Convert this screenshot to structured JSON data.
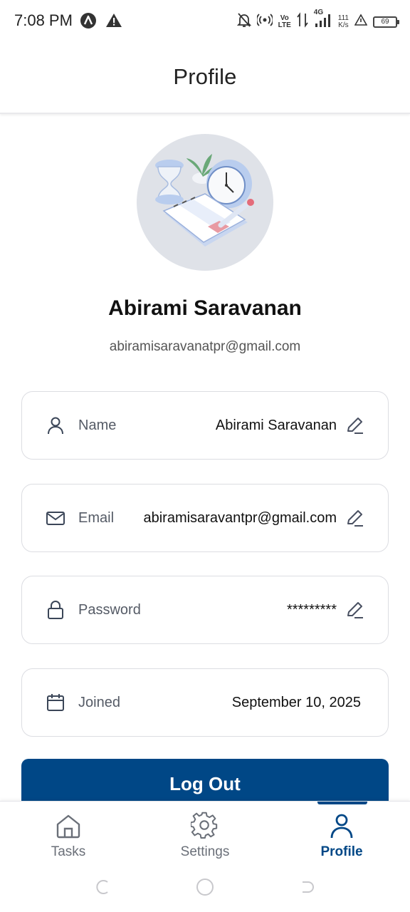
{
  "status_bar": {
    "time": "7:08 PM",
    "network_type": "4G",
    "speed_value": "111",
    "speed_unit": "K/s",
    "battery": "69",
    "volte_top": "Vo",
    "volte_bottom": "LTE",
    "icons": [
      "app-a-icon",
      "warning-icon",
      "bell-off-icon",
      "hotspot-icon",
      "data-arrows-icon",
      "signal-icon",
      "alert-triangle-icon",
      "battery-icon"
    ]
  },
  "header": {
    "title": "Profile"
  },
  "profile": {
    "name": "Abirami Saravanan",
    "email": "abiramisaravanatpr@gmail.com"
  },
  "fields": [
    {
      "label": "Name",
      "value": "Abirami Saravanan",
      "icon": "user-icon",
      "editable": true
    },
    {
      "label": "Email",
      "value": "abiramisaravantpr@gmail.com",
      "icon": "mail-icon",
      "editable": true
    },
    {
      "label": "Password",
      "value": "*********",
      "icon": "lock-icon",
      "editable": true
    },
    {
      "label": "Joined",
      "value": "September 10, 2025",
      "icon": "calendar-icon",
      "editable": false
    }
  ],
  "logout_label": "Log Out",
  "bottom_nav": {
    "active": "Profile",
    "items": [
      {
        "label": "Tasks",
        "icon": "home-icon"
      },
      {
        "label": "Settings",
        "icon": "gear-icon"
      },
      {
        "label": "Profile",
        "icon": "user-icon"
      }
    ]
  },
  "colors": {
    "primary": "#004786",
    "card_border": "#dcdde2",
    "avatar_bg": "#dfe2e8",
    "muted_text": "#555b66"
  }
}
